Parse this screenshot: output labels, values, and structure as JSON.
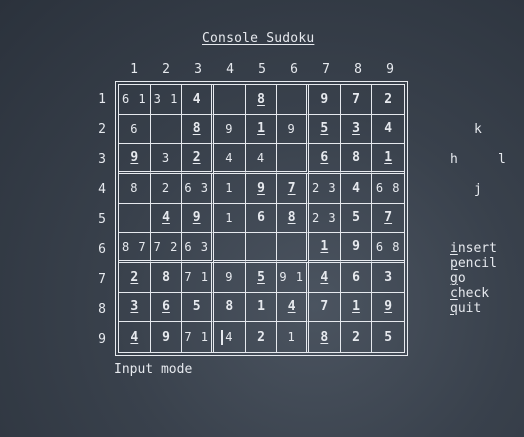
{
  "title": "Console Sudoku",
  "column_labels": [
    "1",
    "2",
    "3",
    "4",
    "5",
    "6",
    "7",
    "8",
    "9"
  ],
  "row_labels": [
    "1",
    "2",
    "3",
    "4",
    "5",
    "6",
    "7",
    "8",
    "9"
  ],
  "grid": [
    [
      {
        "p": "6 1"
      },
      {
        "p": "3 1"
      },
      {
        "v": "4"
      },
      {},
      {
        "v": "8",
        "g": true
      },
      {},
      {
        "v": "9"
      },
      {
        "v": "7"
      },
      {
        "v": "2"
      }
    ],
    [
      {
        "p": "6"
      },
      {},
      {
        "v": "8",
        "g": true
      },
      {
        "p": "9"
      },
      {
        "v": "1",
        "g": true
      },
      {
        "p": "9"
      },
      {
        "v": "5",
        "g": true
      },
      {
        "v": "3",
        "g": true
      },
      {
        "v": "4"
      }
    ],
    [
      {
        "v": "9",
        "g": true
      },
      {
        "p": "3"
      },
      {
        "v": "2",
        "g": true
      },
      {
        "p": "4"
      },
      {
        "p": "4"
      },
      {},
      {
        "v": "6",
        "g": true
      },
      {
        "v": "8"
      },
      {
        "v": "1",
        "g": true
      }
    ],
    [
      {
        "p": "8"
      },
      {
        "p": "2"
      },
      {
        "p": "6 3"
      },
      {
        "p": "1"
      },
      {
        "v": "9",
        "g": true
      },
      {
        "v": "7",
        "g": true
      },
      {
        "p": "2 3"
      },
      {
        "v": "4"
      },
      {
        "p": "6 8"
      }
    ],
    [
      {},
      {
        "v": "4",
        "g": true
      },
      {
        "v": "9",
        "g": true
      },
      {
        "p": "1"
      },
      {
        "v": "6"
      },
      {
        "v": "8",
        "g": true
      },
      {
        "p": "2 3"
      },
      {
        "v": "5"
      },
      {
        "v": "7",
        "g": true
      }
    ],
    [
      {
        "p": "8 7"
      },
      {
        "p": "7 2"
      },
      {
        "p": "6 3"
      },
      {},
      {},
      {},
      {
        "v": "1",
        "g": true
      },
      {
        "v": "9"
      },
      {
        "p": "6 8"
      }
    ],
    [
      {
        "v": "2",
        "g": true
      },
      {
        "v": "8"
      },
      {
        "p": "7 1"
      },
      {
        "p": "9"
      },
      {
        "v": "5",
        "g": true
      },
      {
        "p": "9 1"
      },
      {
        "v": "4",
        "g": true
      },
      {
        "v": "6"
      },
      {
        "v": "3"
      }
    ],
    [
      {
        "v": "3",
        "g": true
      },
      {
        "v": "6",
        "g": true
      },
      {
        "v": "5"
      },
      {
        "v": "8"
      },
      {
        "v": "1"
      },
      {
        "v": "4",
        "g": true
      },
      {
        "v": "7"
      },
      {
        "v": "1",
        "g": true
      },
      {
        "v": "9",
        "g": true
      }
    ],
    [
      {
        "v": "4",
        "g": true
      },
      {
        "v": "9"
      },
      {
        "p": "7 1"
      },
      {
        "p": "4",
        "cursor": true
      },
      {
        "v": "2"
      },
      {
        "p": "1"
      },
      {
        "v": "8",
        "g": true
      },
      {
        "v": "2"
      },
      {
        "v": "5"
      }
    ]
  ],
  "status": "Input mode",
  "hjkl": {
    "up": "k",
    "left": "h",
    "right": "l",
    "down": "j"
  },
  "menu": [
    {
      "key": "i",
      "rest": "nsert"
    },
    {
      "key": "p",
      "rest": "encil"
    },
    {
      "key": "g",
      "rest": "o"
    },
    {
      "key": "c",
      "rest": "heck"
    },
    {
      "key": "q",
      "rest": "uit"
    }
  ]
}
